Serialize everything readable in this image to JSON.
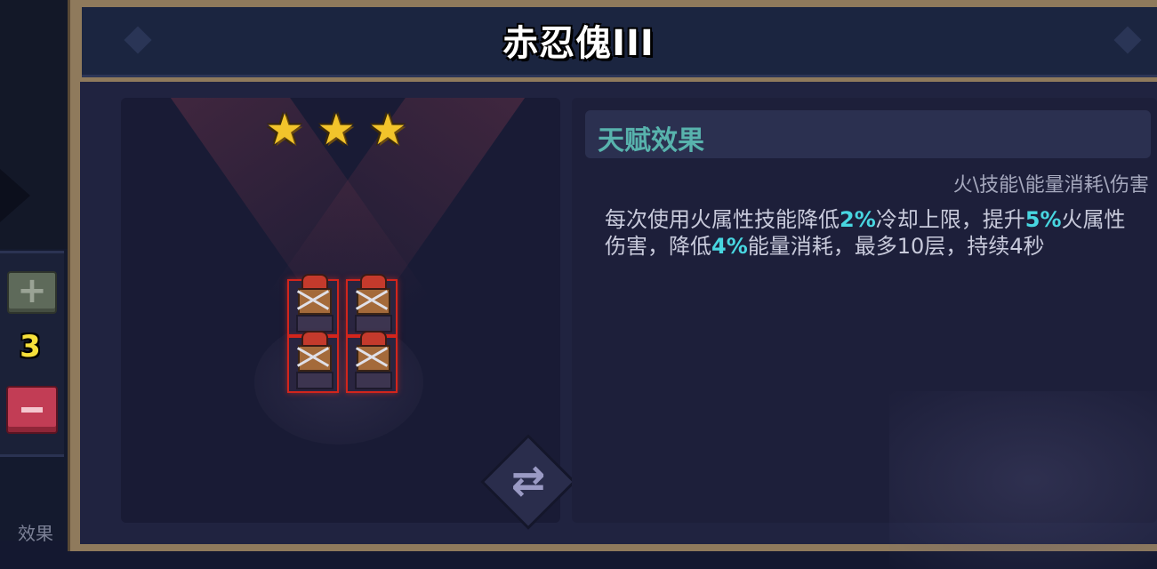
{
  "window": {
    "title": "赤忍傀III"
  },
  "side": {
    "plus_icon": "plus-icon",
    "minus_icon": "minus-icon",
    "count": "3",
    "bottom_label": "效果"
  },
  "preview": {
    "star_count": 3,
    "unit_count": 4,
    "star_glyph": "★",
    "swap_glyph": "⇄"
  },
  "talent": {
    "header": "天赋效果",
    "tags": "火\\技能\\能量消耗\\伤害",
    "desc": {
      "p1": "每次使用火属性技能降低",
      "v1": "2%",
      "p2": "冷却上限，提升",
      "v2": "5%",
      "p3": "火属性伤害，降低",
      "v3": "4%",
      "p4": "能量消耗，最多10层，持续4秒"
    }
  },
  "colors": {
    "highlight": "#48d6e0",
    "header_text": "#58b3ad",
    "star": "#f2c42b",
    "count": "#f6e03a",
    "minus_button": "#c23d55",
    "plus_button": "#5e6a5a"
  }
}
